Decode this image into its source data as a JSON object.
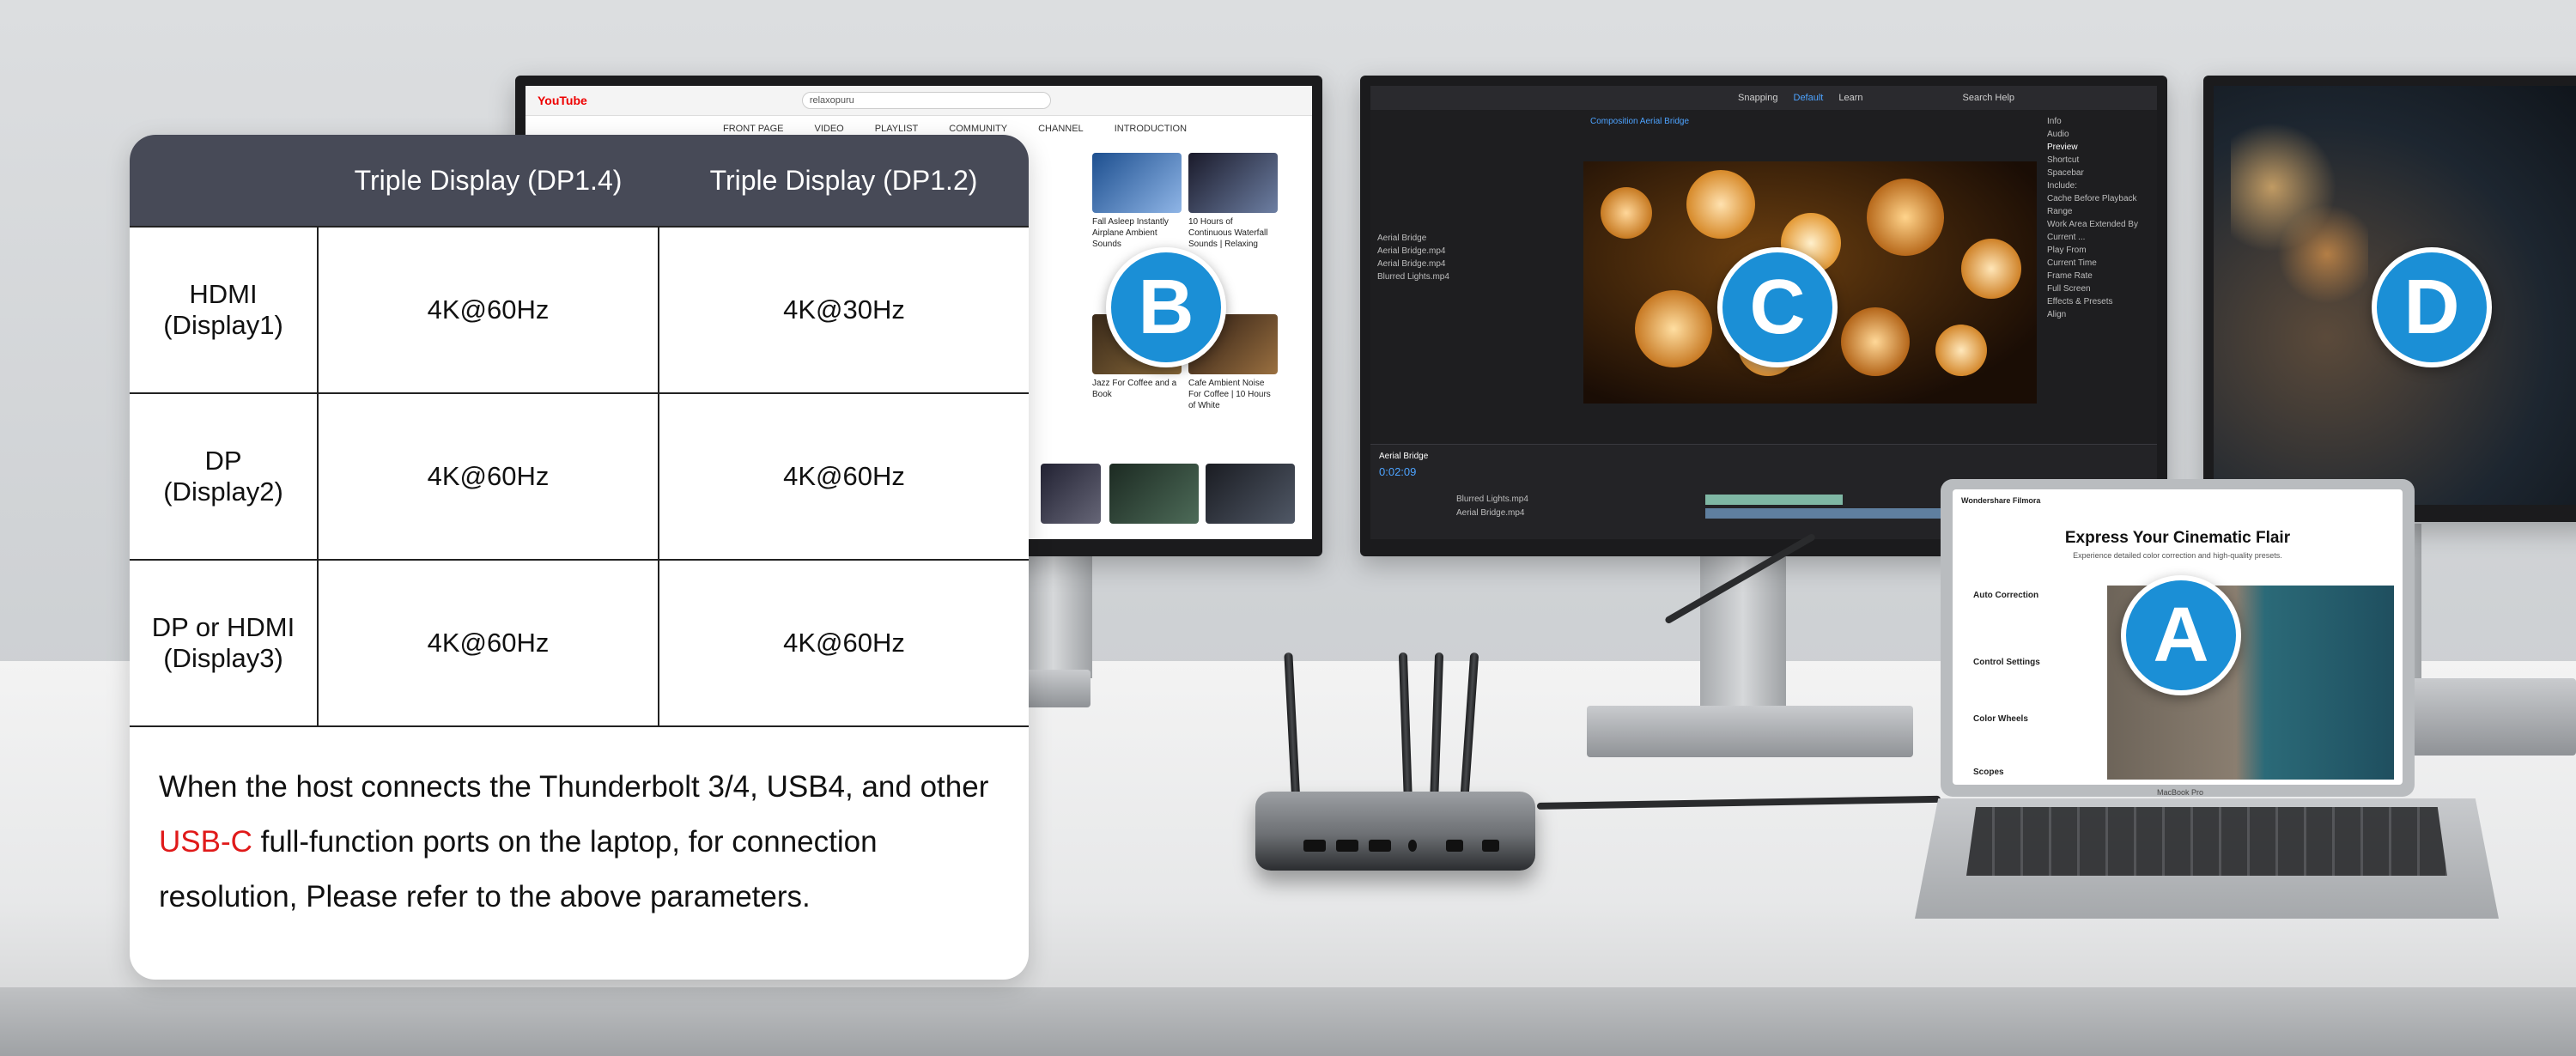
{
  "badges": [
    "A",
    "B",
    "C",
    "D"
  ],
  "table": {
    "headers": [
      "",
      "Triple Display (DP1.4)",
      "Triple Display (DP1.2)"
    ],
    "rows": [
      {
        "label_line1": "HDMI",
        "label_line2": "(Display1)",
        "dp14": "4K@60Hz",
        "dp12": "4K@30Hz"
      },
      {
        "label_line1": "DP",
        "label_line2": "(Display2)",
        "dp14": "4K@60Hz",
        "dp12": "4K@60Hz"
      },
      {
        "label_line1": "DP or HDMI",
        "label_line2": "(Display3)",
        "dp14": "4K@60Hz",
        "dp12": "4K@60Hz"
      }
    ]
  },
  "note": {
    "part1": "When the host connects the Thunderbolt 3/4, USB4, and other ",
    "highlight": "USB-C",
    "part2": " full-function ports on the laptop, for connection resolution, Please refer to the above parameters."
  },
  "colors": {
    "badge": "#1b8fd6",
    "table_header": "#474a57",
    "highlight": "#e01a1a"
  },
  "monitor_b": {
    "logo": "YouTube",
    "search": "relaxopuru",
    "tabs": [
      "FRONT PAGE",
      "VIDEO",
      "PLAYLIST",
      "COMMUNITY",
      "CHANNEL",
      "INTRODUCTION"
    ],
    "thumbs": [
      {
        "title": "Fall Asleep Instantly Airplane Ambient Sounds"
      },
      {
        "title": "10 Hours of Continuous Waterfall Sounds | Relaxing"
      },
      {
        "title": "Jazz For Coffee and a Book"
      },
      {
        "title": "Cafe Ambient Noise For Coffee | 10 Hours of White"
      }
    ]
  },
  "monitor_c": {
    "menu": [
      "Snapping",
      "Default",
      "Learn",
      "Search Help"
    ],
    "project_items": [
      "Aerial Bridge",
      "Aerial Bridge.mp4",
      "Aerial Bridge.mp4",
      "Blurred Lights.mp4"
    ],
    "composition_tab": "Composition Aerial Bridge",
    "right_panel": [
      "Info",
      "Audio",
      "Preview",
      "Shortcut",
      "Spacebar",
      "Include:",
      "Cache Before Playback",
      "Range",
      "Work Area Extended By Current ...",
      "Play From",
      "Current Time",
      "Frame Rate",
      "Full Screen",
      "Effects & Presets",
      "Align"
    ],
    "timeline_tab": "Aerial Bridge",
    "timecode": "0:02:09",
    "layers": [
      "Blurred Lights.mp4",
      "Aerial Bridge.mp4"
    ]
  },
  "laptop": {
    "brand": "Wondershare Filmora",
    "headline": "Express Your Cinematic Flair",
    "subtitle": "Experience detailed color correction and high-quality presets.",
    "features": [
      "Auto Correction",
      "Control Settings",
      "Color Wheels",
      "Scopes"
    ],
    "model": "MacBook Pro"
  }
}
